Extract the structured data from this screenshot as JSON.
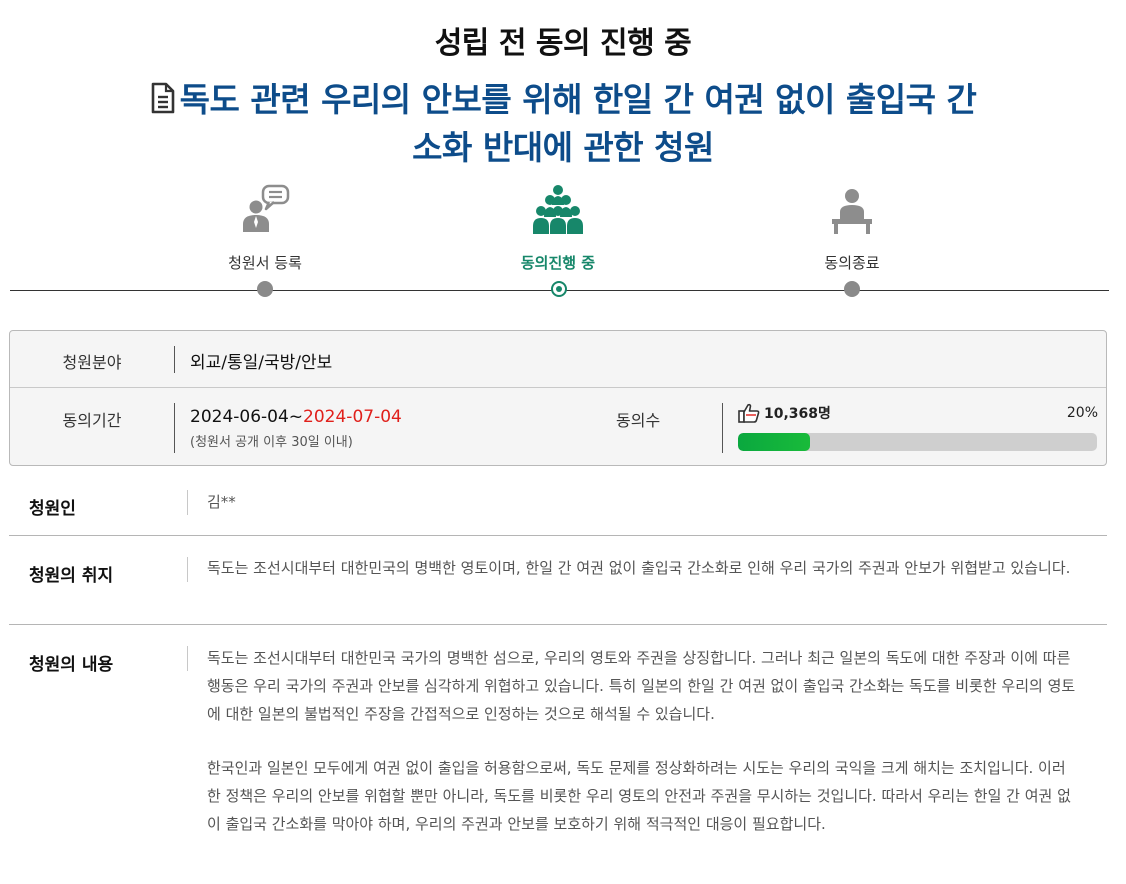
{
  "status": "성립 전 동의 진행 중",
  "title": {
    "line1": "독도 관련 우리의 안보를 위해 한일 간 여권 없이 출입국 간",
    "line2": "소화 반대에 관한 청원",
    "icon": "document-icon"
  },
  "steps": [
    {
      "label": "청원서 등록",
      "icon": "speech-person-icon",
      "active": false
    },
    {
      "label": "동의진행 중",
      "icon": "group-people-icon",
      "active": true
    },
    {
      "label": "동의종료",
      "icon": "podium-person-icon",
      "active": false
    }
  ],
  "info": {
    "category_label": "청원분야",
    "category_value": "외교/통일/국방/안보",
    "period_label": "동의기간",
    "period_start": "2024-06-04~",
    "period_end": "2024-07-04",
    "period_note": "(청원서 공개 이후 30일 이내)",
    "count_label": "동의수",
    "count_value": "10,368명",
    "percent_text": "20%",
    "progress_fraction": 0.2
  },
  "petitioner": {
    "label": "청원인",
    "value": "김**"
  },
  "purpose": {
    "label": "청원의 취지",
    "text": "독도는 조선시대부터 대한민국의 명백한 영토이며, 한일 간 여권 없이 출입국 간소화로 인해 우리 국가의 주권과 안보가 위협받고 있습니다."
  },
  "content": {
    "label": "청원의 내용",
    "paragraphs": [
      "독도는 조선시대부터 대한민국 국가의 명백한 섬으로, 우리의 영토와 주권을 상징합니다. 그러나 최근 일본의 독도에 대한 주장과 이에 따른 행동은 우리 국가의 주권과 안보를 심각하게 위협하고 있습니다. 특히 일본의 한일 간 여권 없이 출입국 간소화는 독도를 비롯한 우리의 영토에 대한 일본의 불법적인 주장을 간접적으로 인정하는 것으로 해석될 수 있습니다.",
      "한국인과 일본인 모두에게 여권 없이 출입을 허용함으로써, 독도 문제를 정상화하려는 시도는 우리의 국익을 크게 해치는 조치입니다. 이러한 정책은 우리의 안보를 위협할 뿐만 아니라, 독도를 비롯한 우리 영토의 안전과 주권을 무시하는 것입니다. 따라서 우리는 한일 간 여권 없이 출입국 간소화를 막아야 하며, 우리의 주권과 안보를 보호하기 위해 적극적인 대응이 필요합니다."
    ]
  },
  "colors": {
    "title": "#0d4c8a",
    "active_step": "#17876a",
    "date_end": "#e0201b",
    "progress": "#0aa83f"
  }
}
